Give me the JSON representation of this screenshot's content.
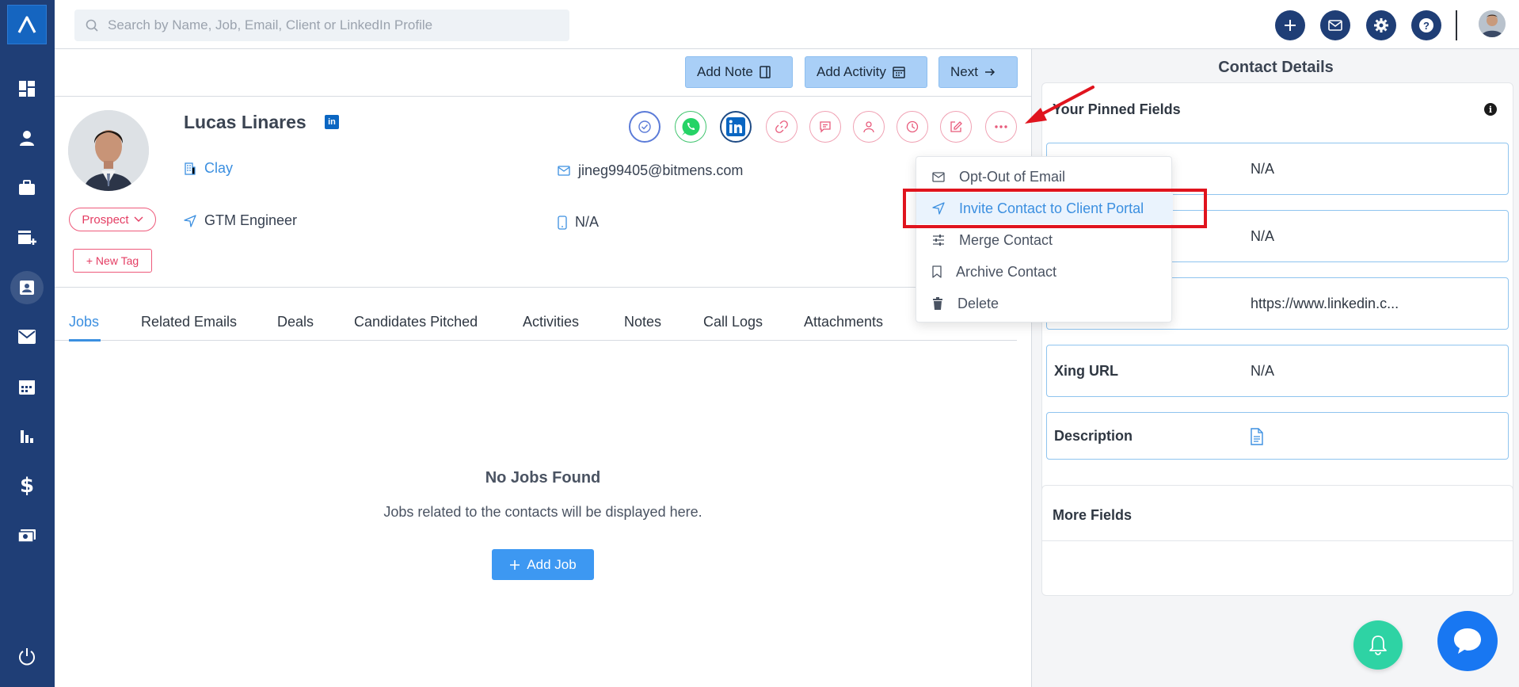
{
  "search": {
    "placeholder": "Search by Name, Job, Email, Client or LinkedIn Profile"
  },
  "actions": {
    "add_note": "Add Note",
    "add_activity": "Add Activity",
    "next": "Next"
  },
  "contact": {
    "name": "Lucas Linares",
    "linkedin_badge": "in",
    "company": "Clay",
    "title": "GTM Engineer",
    "email": "jineg99405@bitmens.com",
    "phone": "N/A",
    "status": "Prospect",
    "new_tag": "+ New Tag"
  },
  "tabs": [
    "Jobs",
    "Related Emails",
    "Deals",
    "Candidates Pitched",
    "Activities",
    "Notes",
    "Call Logs",
    "Attachments"
  ],
  "empty_state": {
    "title": "No Jobs Found",
    "subtitle": "Jobs related to the contacts will be displayed here.",
    "button": "Add Job"
  },
  "menu": {
    "items": [
      "Opt-Out of Email",
      "Invite Contact to Client Portal",
      "Merge Contact",
      "Archive Contact",
      "Delete"
    ],
    "highlighted": "Invite Contact to Client Portal"
  },
  "right_panel": {
    "title": "Contact Details",
    "pinned_header": "Your Pinned Fields",
    "info_glyph": "i",
    "fields": [
      {
        "label": "",
        "value": "N/A"
      },
      {
        "label": "",
        "value": "N/A"
      },
      {
        "label": "",
        "value": "https://www.linkedin.c..."
      },
      {
        "label": "Xing URL",
        "value": "N/A"
      },
      {
        "label": "Description",
        "value": ""
      }
    ],
    "more_fields": "More Fields"
  },
  "colors": {
    "sidebar": "#1f3e76",
    "accent": "#3b8fe0",
    "tag": "#e43d63",
    "highlight": "#e0141e"
  }
}
